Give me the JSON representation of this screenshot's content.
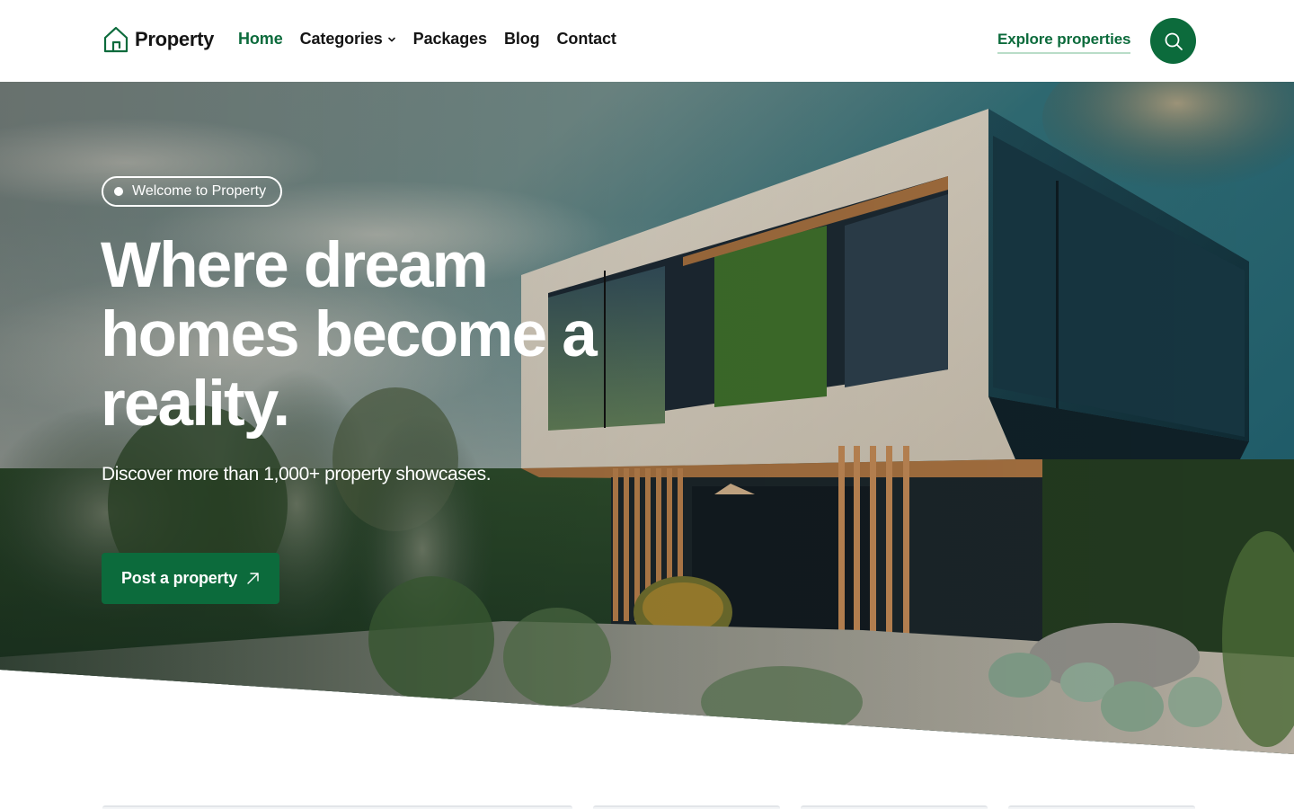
{
  "header": {
    "logo_icon": "house-icon",
    "brand": "Property",
    "nav": [
      {
        "label": "Home",
        "active": true
      },
      {
        "label": "Categories",
        "has_dropdown": true,
        "icon": "chevron-down-icon"
      },
      {
        "label": "Packages"
      },
      {
        "label": "Blog"
      },
      {
        "label": "Contact"
      }
    ],
    "explore_link": "Explore properties",
    "search_icon": "search-icon"
  },
  "hero": {
    "badge": "Welcome to Property",
    "title_lines": [
      "Where dream",
      "homes become a",
      "reality."
    ],
    "subtitle": "Discover more than 1,000+ property showcases.",
    "cta_label": "Post a property",
    "cta_icon": "arrow-up-right-icon",
    "background": "modern-house-photo"
  },
  "filter_bar": {
    "fields": [
      {
        "name": "field-1"
      },
      {
        "name": "field-2"
      },
      {
        "name": "field-3"
      },
      {
        "name": "field-4"
      }
    ]
  },
  "colors": {
    "brand_green": "#0c6b3c",
    "explore_underline": "#b9ddc8",
    "text_dark": "#151515"
  }
}
